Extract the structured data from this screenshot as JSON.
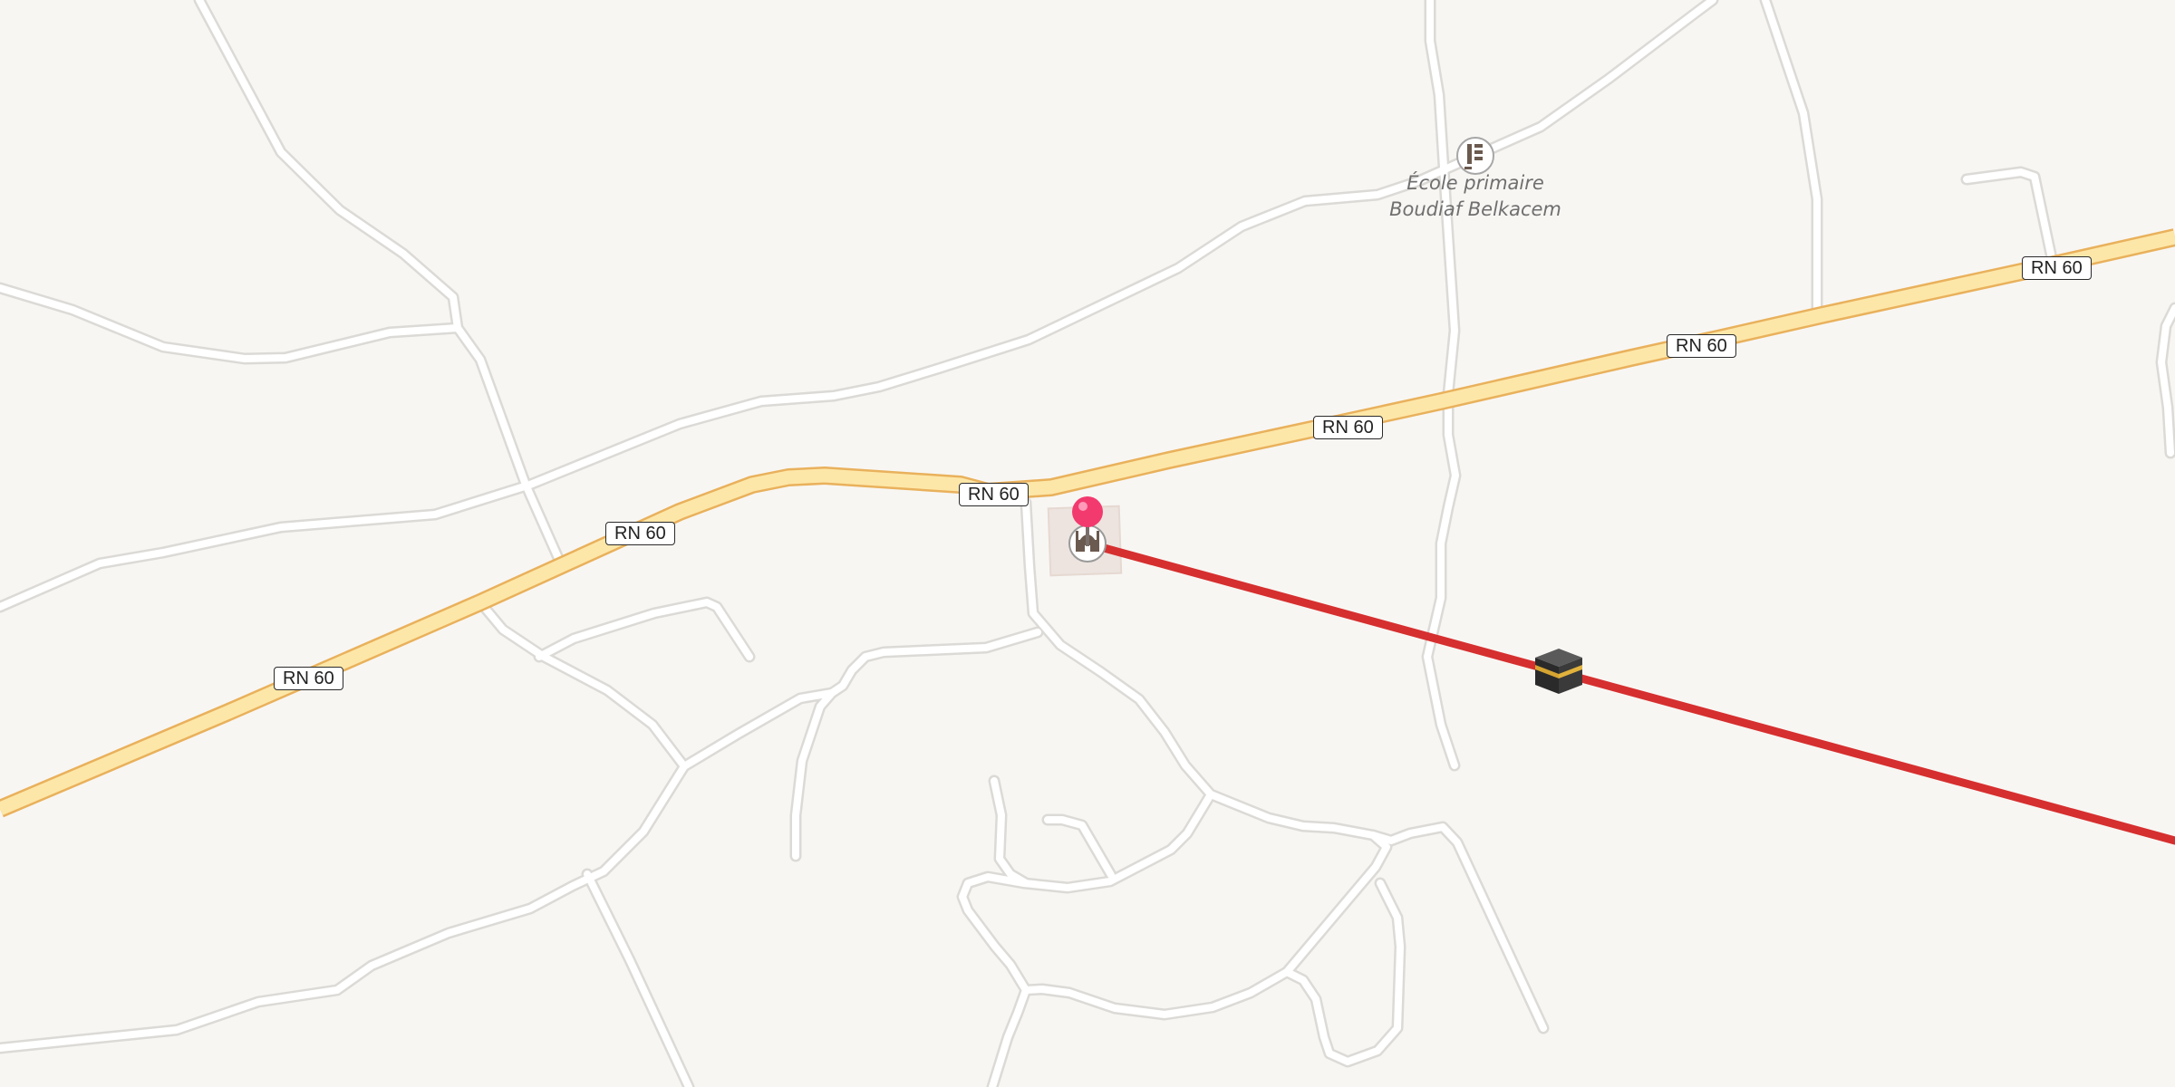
{
  "map": {
    "colors": {
      "background": "#f8f6f3",
      "minor_road": "#ffffff",
      "minor_road_casing": "#dcdad6",
      "primary_road": "#fde7a8",
      "primary_road_casing": "#e9b15c",
      "route_line": "#d62f2f",
      "pin": "#f23a6e"
    },
    "road_labels": [
      "RN 60",
      "RN 60",
      "RN 60",
      "RN 60",
      "RN 60",
      "RN 60"
    ],
    "pois": [
      {
        "name_line1": "École primaire",
        "name_line2": "Boudiaf Belkacem",
        "icon": "school-icon"
      },
      {
        "icon": "mosque-icon"
      }
    ],
    "markers": [
      {
        "icon": "location-pin-icon"
      },
      {
        "icon": "kaaba-icon"
      }
    ]
  }
}
